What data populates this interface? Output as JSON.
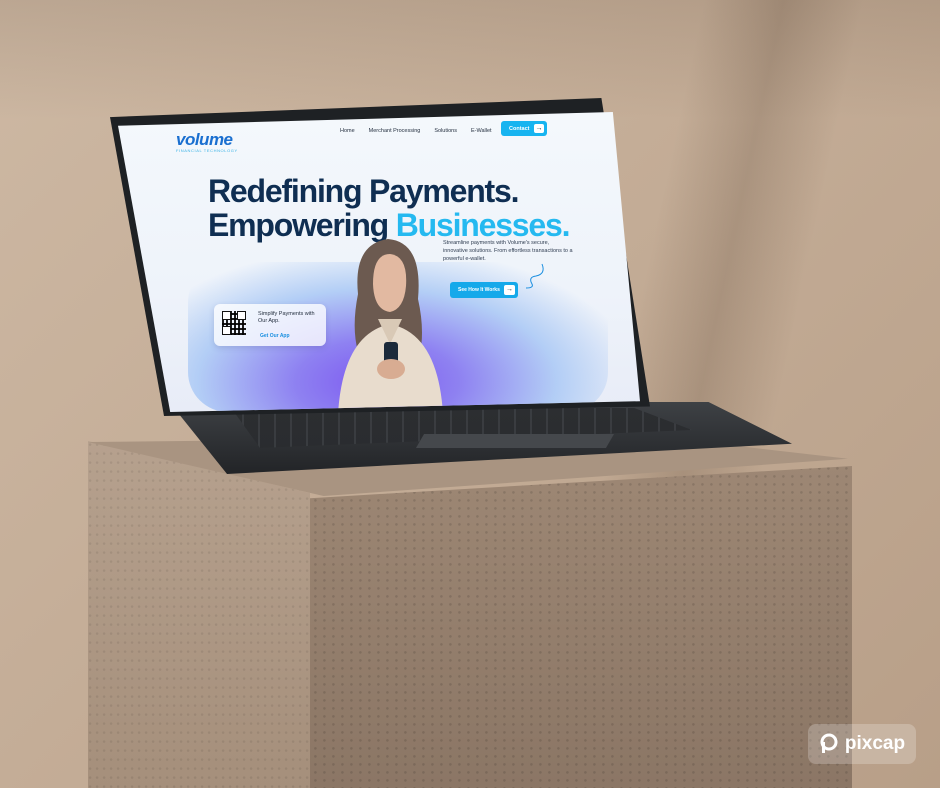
{
  "page": {
    "logo": {
      "main": "volume",
      "sub": "FINANCIAL TECHNOLOGY"
    },
    "nav": {
      "items": [
        "Home",
        "Merchant Processing",
        "Solutions",
        "E-Wallet"
      ],
      "contact_label": "Contact"
    },
    "hero": {
      "headline_line1": "Redefining Payments.",
      "headline_line2_a": "Empowering ",
      "headline_line2_b": "Businesses.",
      "subtext": "Streamline payments with Volume's secure, innovative solutions. From effortless transactions to a powerful e-wallet.",
      "cta_label": "See How It Works"
    },
    "app_card": {
      "title": "Simplify Payments with Our App.",
      "link_label": "Get Our App"
    }
  },
  "watermark": "pixcap",
  "colors": {
    "accent": "#25b9f0",
    "navy": "#0f2e52",
    "button": "#17b4f0"
  }
}
